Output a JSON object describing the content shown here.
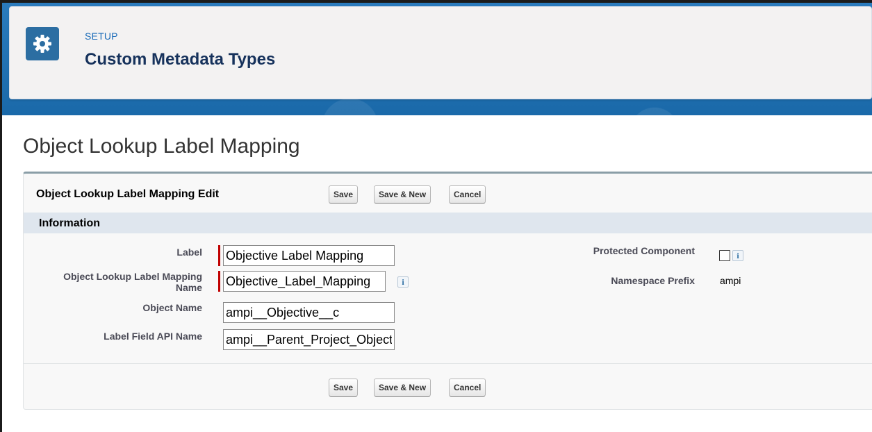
{
  "header": {
    "eyebrow": "SETUP",
    "title": "Custom Metadata Types",
    "icon": "gear-icon"
  },
  "record_title": "Object Lookup Label Mapping",
  "panel": {
    "title": "Object Lookup Label Mapping Edit",
    "buttons": {
      "save": "Save",
      "save_new": "Save & New",
      "cancel": "Cancel"
    }
  },
  "section": {
    "title": "Information"
  },
  "fields": {
    "label": {
      "label": "Label",
      "value": "Objective Label Mapping",
      "required": true
    },
    "mapping_name": {
      "label_line1": "Object Lookup Label Mapping",
      "label_line2": "Name",
      "value": "Objective_Label_Mapping",
      "required": true
    },
    "object_name": {
      "label": "Object Name",
      "value": "ampi__Objective__c"
    },
    "label_field_api": {
      "label": "Label Field API Name",
      "value": "ampi__Parent_Project_Objective__c"
    },
    "protected": {
      "label": "Protected Component",
      "checked": false
    },
    "namespace": {
      "label": "Namespace Prefix",
      "value": "ampi"
    }
  },
  "colors": {
    "brand_blue": "#1d6fb0",
    "required_red": "#c00000",
    "section_bg": "#dfe6ee"
  }
}
